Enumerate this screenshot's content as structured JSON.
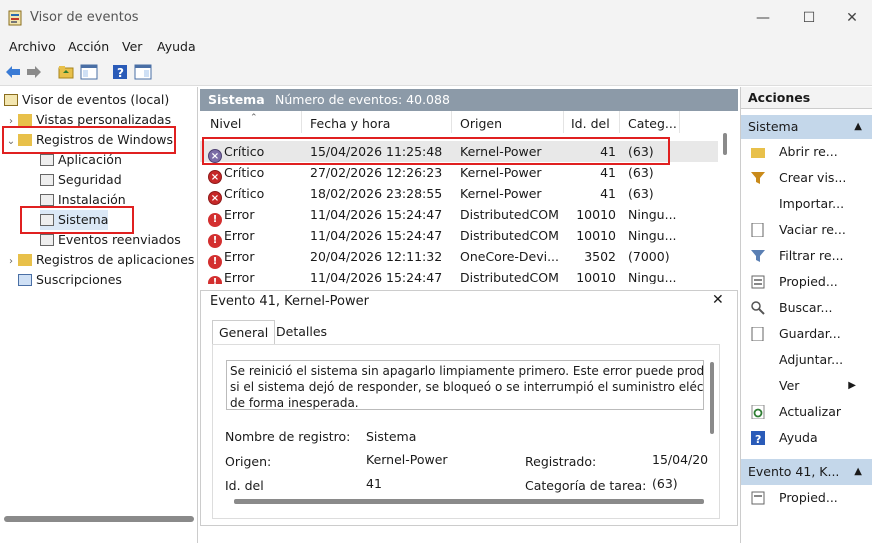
{
  "window": {
    "title": "Visor de eventos"
  },
  "menu": [
    "Archivo",
    "Acción",
    "Ver",
    "Ayuda"
  ],
  "tree": {
    "root": "Visor de eventos (local)",
    "custom": "Vistas personalizadas",
    "winlogs": "Registros de Windows",
    "children": [
      "Aplicación",
      "Seguridad",
      "Instalación",
      "Sistema",
      "Eventos reenviados"
    ],
    "applogs": "Registros de aplicaciones",
    "subs": "Suscripciones"
  },
  "header": {
    "name": "Sistema",
    "count": "Número de eventos: 40.088"
  },
  "columns": [
    "Nivel",
    "Fecha y hora",
    "Origen",
    "Id. del ...",
    "Categ..."
  ],
  "rows": [
    {
      "level": "Crítico",
      "date": "15/04/2026 11:25:48",
      "source": "Kernel-Power",
      "id": "41",
      "cat": "(63)"
    },
    {
      "level": "Crítico",
      "date": "27/02/2026 12:26:23",
      "source": "Kernel-Power",
      "id": "41",
      "cat": "(63)"
    },
    {
      "level": "Crítico",
      "date": "18/02/2026 23:28:55",
      "source": "Kernel-Power",
      "id": "41",
      "cat": "(63)"
    },
    {
      "level": "Error",
      "date": "11/04/2026 15:24:47",
      "source": "DistributedCOM",
      "id": "10010",
      "cat": "Ningu..."
    },
    {
      "level": "Error",
      "date": "11/04/2026 15:24:47",
      "source": "DistributedCOM",
      "id": "10010",
      "cat": "Ningu..."
    },
    {
      "level": "Error",
      "date": "20/04/2026 12:11:32",
      "source": "OneCore-Devi...",
      "id": "3502",
      "cat": "(7000)"
    },
    {
      "level": "Error",
      "date": "11/04/2026 15:24:47",
      "source": "DistributedCOM",
      "id": "10010",
      "cat": "Ningu..."
    }
  ],
  "detail": {
    "title": "Evento 41, Kernel-Power",
    "tabs": [
      "General",
      "Detalles"
    ],
    "message": [
      "Se reinició el sistema sin apagarlo limpiamente primero. Este error puede produc",
      "si el sistema dejó de responder, se bloqueó o se interrumpió el suministro eléctr",
      "de forma inesperada."
    ],
    "log_label": "Nombre de registro:",
    "log_value": "Sistema",
    "source_label": "Origen:",
    "source_value": "Kernel-Power",
    "recorded_label": "Registrado:",
    "recorded_value": "15/04/20",
    "id_label": "Id. del",
    "id_value": "41",
    "task_label": "Categoría de tarea:",
    "task_value": "(63)"
  },
  "actions": {
    "title": "Acciones",
    "section1": "Sistema",
    "items": [
      "Abrir re...",
      "Crear vis...",
      "Importar...",
      "Vaciar re...",
      "Filtrar re...",
      "Propied...",
      "Buscar...",
      "Guardar...",
      "Adjuntar...",
      "Ver",
      "Actualizar",
      "Ayuda"
    ],
    "section2": "Evento 41, K...",
    "items2": [
      "Propied..."
    ]
  }
}
